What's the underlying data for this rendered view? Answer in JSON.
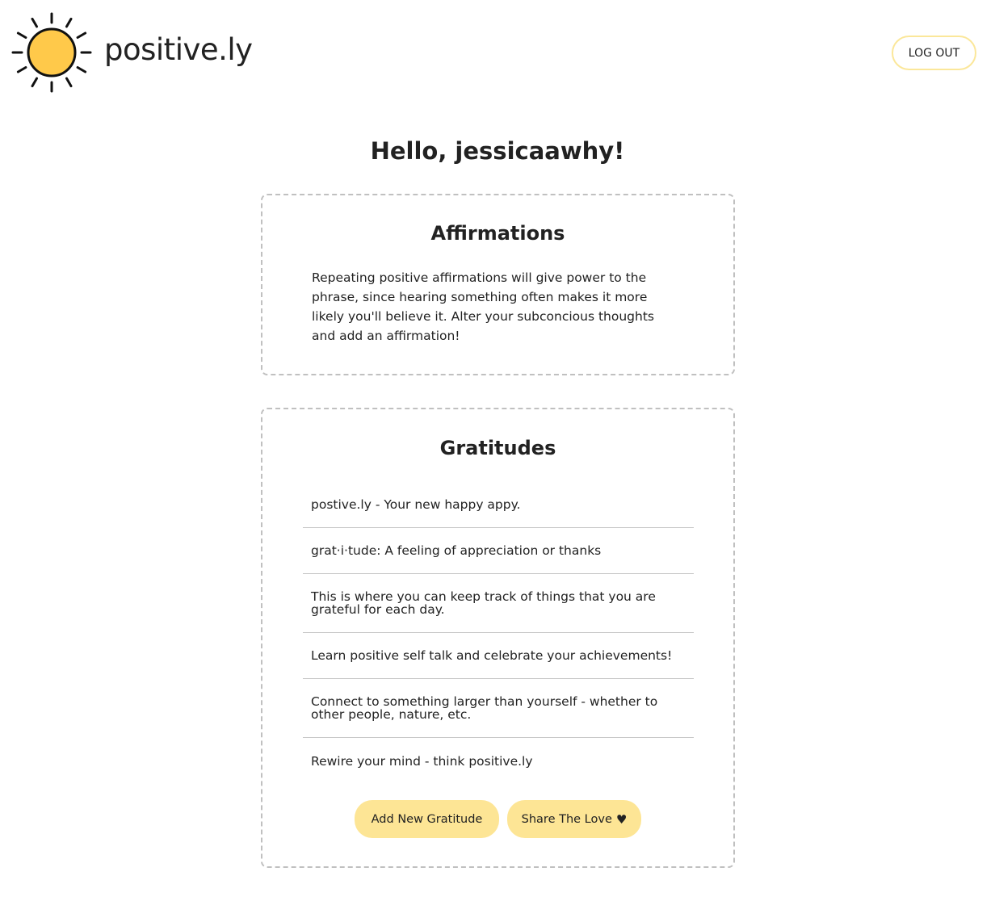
{
  "header": {
    "logo_icon": "sun-icon",
    "logo_text": "positive.ly",
    "logout_label": "LOG OUT"
  },
  "greeting": "Hello, jessicaawhy!",
  "affirmations": {
    "title": "Affirmations",
    "description": "Repeating positive affirmations will give power to the phrase, since hearing something often makes it more likely you'll believe it. Alter your subconcious thoughts and add an affirmation!"
  },
  "gratitudes": {
    "title": "Gratitudes",
    "items": [
      "postive.ly - Your new happy appy.",
      "grat·i·tude: A feeling of appreciation or thanks",
      "This is where you can keep track of things that you are grateful for each day.",
      "Learn positive self talk and celebrate your achievements!",
      "Connect to something larger than yourself - whether to other people, nature, etc.",
      "Rewire your mind - think positive.ly"
    ],
    "add_button_label": "Add New Gratitude",
    "share_button_label": "Share The Love",
    "share_button_icon": "heart-icon",
    "share_button_icon_glyph": "♥"
  },
  "colors": {
    "accent": "#fde595",
    "logout_border": "#fbe79a",
    "sun_fill": "#ffc94a",
    "text": "#222222",
    "dashed_border": "#c0c0c0"
  }
}
